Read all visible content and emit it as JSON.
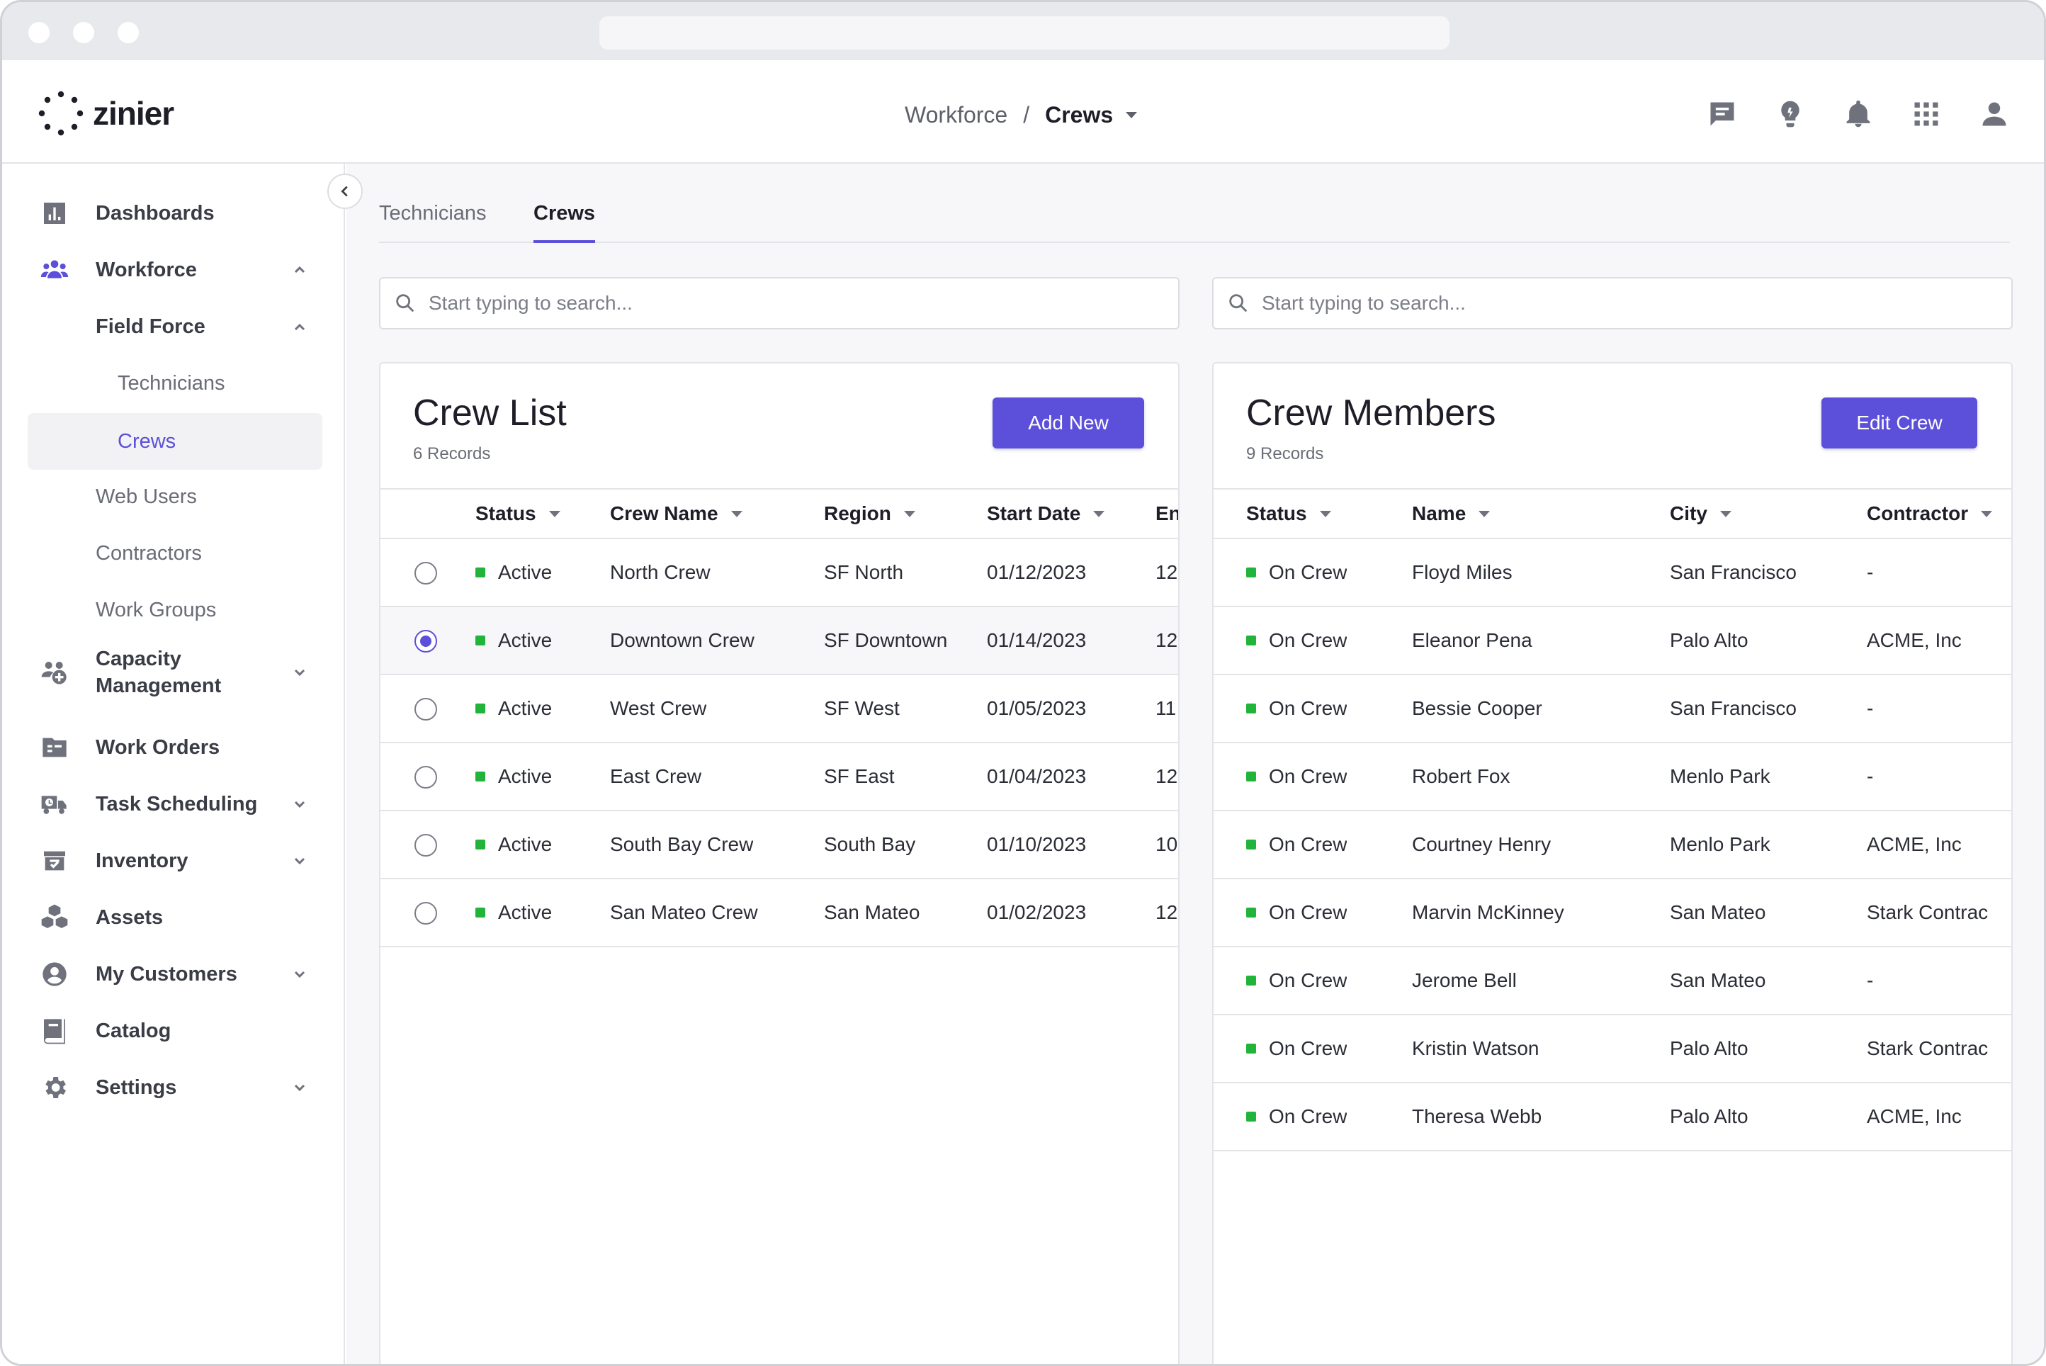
{
  "app": {
    "logo_text": "zinier",
    "breadcrumb": {
      "parent": "Workforce",
      "separator": "/",
      "current": "Crews"
    }
  },
  "header_icons": [
    "chat-icon",
    "lightbulb-icon",
    "bell-icon",
    "apps-grid-icon",
    "user-icon"
  ],
  "sidebar": {
    "items": [
      {
        "label": "Dashboards",
        "icon": "chart-icon"
      },
      {
        "label": "Workforce",
        "icon": "people-icon"
      },
      {
        "label": "Field Force"
      },
      {
        "label": "Technicians"
      },
      {
        "label": "Crews"
      },
      {
        "label": "Web Users"
      },
      {
        "label": "Contractors"
      },
      {
        "label": "Work Groups"
      },
      {
        "label": "Capacity Management",
        "icon": "capacity-icon"
      },
      {
        "label": "Work Orders",
        "icon": "folder-icon"
      },
      {
        "label": "Task Scheduling",
        "icon": "truck-icon"
      },
      {
        "label": "Inventory",
        "icon": "inventory-icon"
      },
      {
        "label": "Assets",
        "icon": "cubes-icon"
      },
      {
        "label": "My Customers",
        "icon": "account-icon"
      },
      {
        "label": "Catalog",
        "icon": "book-icon"
      },
      {
        "label": "Settings",
        "icon": "gear-icon"
      }
    ]
  },
  "tabs": [
    {
      "label": "Technicians"
    },
    {
      "label": "Crews"
    }
  ],
  "search": {
    "left_placeholder": "Start typing to search...",
    "right_placeholder": "Start typing to search..."
  },
  "crew_list": {
    "title": "Crew List",
    "count": "6 Records",
    "button": "Add New",
    "columns": [
      "Status",
      "Crew Name",
      "Region",
      "Start Date",
      "En"
    ],
    "rows": [
      {
        "status": "Active",
        "name": "North Crew",
        "region": "SF North",
        "start": "01/12/2023",
        "end": "12"
      },
      {
        "status": "Active",
        "name": "Downtown Crew",
        "region": "SF Downtown",
        "start": "01/14/2023",
        "end": "12"
      },
      {
        "status": "Active",
        "name": "West Crew",
        "region": "SF West",
        "start": "01/05/2023",
        "end": "11"
      },
      {
        "status": "Active",
        "name": "East Crew",
        "region": "SF East",
        "start": "01/04/2023",
        "end": "12"
      },
      {
        "status": "Active",
        "name": "South Bay Crew",
        "region": "South Bay",
        "start": "01/10/2023",
        "end": "10"
      },
      {
        "status": "Active",
        "name": "San Mateo Crew",
        "region": "San Mateo",
        "start": "01/02/2023",
        "end": "12"
      }
    ]
  },
  "crew_members": {
    "title": "Crew Members",
    "count": "9 Records",
    "button": "Edit Crew",
    "columns": [
      "Status",
      "Name",
      "City",
      "Contractor"
    ],
    "rows": [
      {
        "status": "On Crew",
        "name": "Floyd Miles",
        "city": "San Francisco",
        "contractor": "-"
      },
      {
        "status": "On Crew",
        "name": "Eleanor Pena",
        "city": "Palo Alto",
        "contractor": "ACME, Inc"
      },
      {
        "status": "On Crew",
        "name": "Bessie Cooper",
        "city": "San Francisco",
        "contractor": "-"
      },
      {
        "status": "On Crew",
        "name": "Robert Fox",
        "city": "Menlo Park",
        "contractor": "-"
      },
      {
        "status": "On Crew",
        "name": "Courtney Henry",
        "city": "Menlo Park",
        "contractor": "ACME, Inc"
      },
      {
        "status": "On Crew",
        "name": "Marvin McKinney",
        "city": "San Mateo",
        "contractor": "Stark Contrac"
      },
      {
        "status": "On Crew",
        "name": "Jerome Bell",
        "city": "San Mateo",
        "contractor": "-"
      },
      {
        "status": "On Crew",
        "name": "Kristin Watson",
        "city": "Palo Alto",
        "contractor": "Stark Contrac"
      },
      {
        "status": "On Crew",
        "name": "Theresa Webb",
        "city": "Palo Alto",
        "contractor": "ACME, Inc"
      }
    ]
  },
  "colors": {
    "accent": "#5c4fd9",
    "status_green": "#22b33a",
    "background": "#f7f7f9"
  }
}
